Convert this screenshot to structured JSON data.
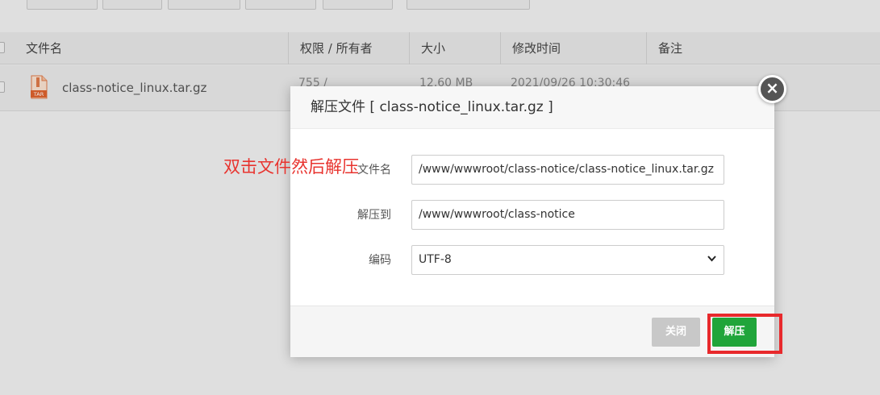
{
  "table": {
    "columns": [
      "文件名",
      "权限 / 所有者",
      "大小",
      "修改时间",
      "备注"
    ],
    "row": {
      "file_icon_label": "TAR",
      "file_name": "class-notice_linux.tar.gz",
      "permission_partial": "755 /",
      "size_partial": "12.60 MB",
      "modified_partial": "2021/09/26 10:30:46"
    }
  },
  "dialog": {
    "title": "解压文件 [ class-notice_linux.tar.gz ]",
    "close_symbol": "×",
    "fields": {
      "filename_label": "文件名",
      "filename_value": "/www/wwwroot/class-notice/class-notice_linux.tar.gz",
      "extract_to_label": "解压到",
      "extract_to_value": "/www/wwwroot/class-notice",
      "encoding_label": "编码",
      "encoding_value": "UTF-8"
    },
    "buttons": {
      "close": "关闭",
      "extract": "解压"
    }
  },
  "annotation": {
    "text": "双击文件然后解压",
    "color": "#e8342f"
  },
  "colors": {
    "extract_button": "#20a53a",
    "highlight_border": "#e8292c"
  }
}
